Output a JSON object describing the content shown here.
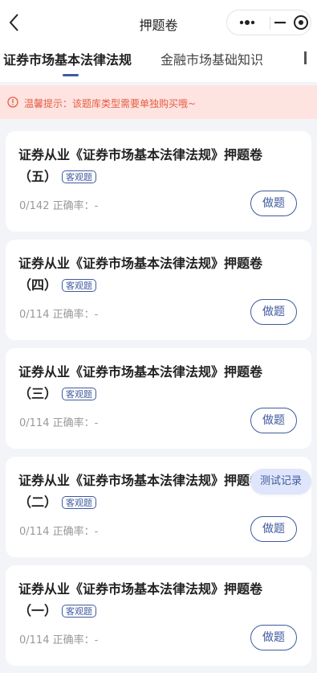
{
  "nav": {
    "title": "押题卷",
    "back_icon": "chevron-left-icon",
    "more_icon": "more-dots-icon",
    "minimize_icon": "minus-icon",
    "close_icon": "target-close-icon"
  },
  "tabs": [
    {
      "label": "证券市场基本法律法规",
      "active": true
    },
    {
      "label": "金融市场基础知识",
      "active": false
    }
  ],
  "notice": {
    "text": "温馨提示：该题库类型需要单独购买哦~",
    "icon": "alert-circle-icon"
  },
  "papers": [
    {
      "title": "证券从业《证券市场基本法律法规》押题卷",
      "part": "（五）",
      "tag": "客观题",
      "progress": "0/142",
      "accuracy_label": "正确率：",
      "accuracy": "-",
      "action": "做题"
    },
    {
      "title": "证券从业《证券市场基本法律法规》押题卷",
      "part": "（四）",
      "tag": "客观题",
      "progress": "0/114",
      "accuracy_label": "正确率：",
      "accuracy": "-",
      "action": "做题"
    },
    {
      "title": "证券从业《证券市场基本法律法规》押题卷",
      "part": "（三）",
      "tag": "客观题",
      "progress": "0/114",
      "accuracy_label": "正确率：",
      "accuracy": "-",
      "action": "做题"
    },
    {
      "title": "证券从业《证券市场基本法律法规》押题卷",
      "part": "（二）",
      "tag": "客观题",
      "progress": "0/114",
      "accuracy_label": "正确率：",
      "accuracy": "-",
      "action": "做题"
    },
    {
      "title": "证券从业《证券市场基本法律法规》押题卷",
      "part": "（一）",
      "tag": "客观题",
      "progress": "0/114",
      "accuracy_label": "正确率：",
      "accuracy": "-",
      "action": "做题"
    }
  ],
  "float_button": {
    "label": "测试记录"
  },
  "colors": {
    "accent": "#3f5a9e",
    "notice_bg": "#fde4e0",
    "notice_text": "#e85b45",
    "page_bg": "#f3f4f7"
  }
}
